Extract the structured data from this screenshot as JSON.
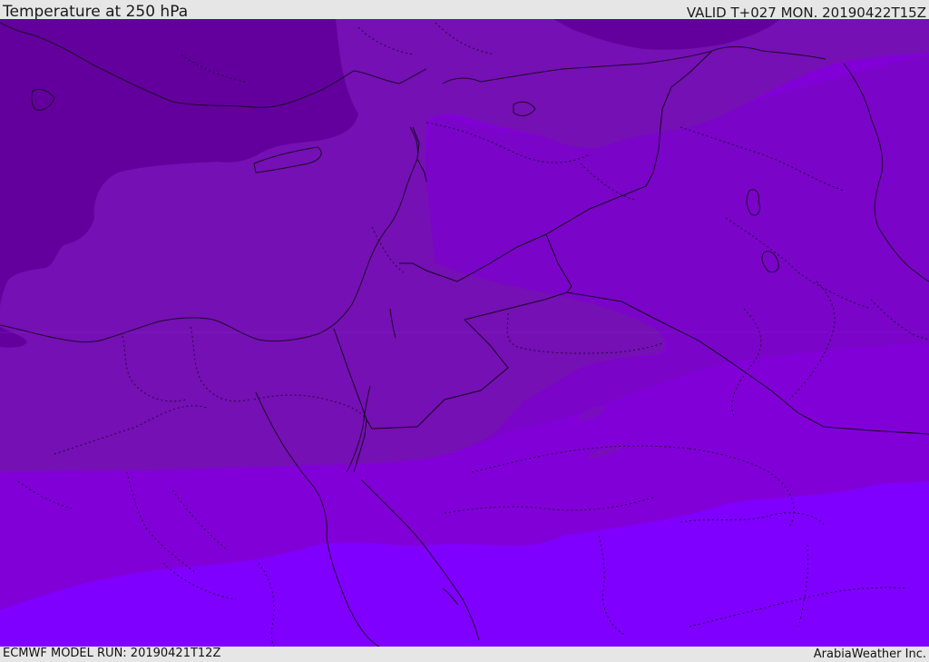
{
  "header": {
    "title": "Temperature at 250 hPa",
    "valid_time": "VALID T+027 MON. 20190422T15Z"
  },
  "footer": {
    "model_run": "ECMWF MODEL RUN: 20190421T12Z",
    "credit": "ArabiaWeather Inc."
  },
  "map": {
    "variable": "temperature",
    "level_hpa": 250,
    "colors": {
      "band_coldest": "#63009d",
      "band_cold": "#7510b4",
      "band_mid": "#8200d8",
      "band_warm": "#8a00f0",
      "band_warmest": "#8000ff",
      "coastline": "#1c0a2a",
      "border": "#14051f"
    }
  }
}
